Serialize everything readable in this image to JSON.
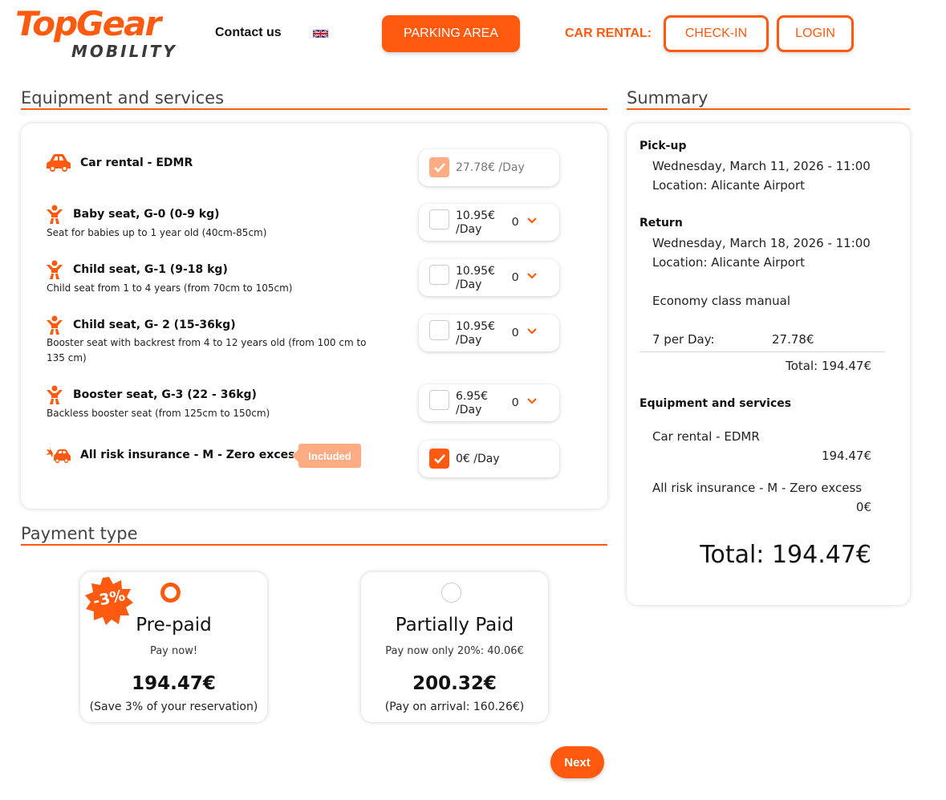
{
  "header": {
    "logo_top": "TopGear",
    "logo_bottom": "MOBILITY",
    "contact_label": "Contact us",
    "parking_label": "PARKING AREA",
    "car_rental_label": "CAR RENTAL:",
    "checkin_label": "CHECK-IN",
    "login_label": "LOGIN"
  },
  "equipment": {
    "title": "Equipment and services",
    "items": [
      {
        "title": "Car rental - EDMR",
        "desc": "",
        "price": "27.78€ /Day",
        "checked": true,
        "disabled": true
      },
      {
        "title": "Baby seat, G-0 (0-9 kg)",
        "desc": "Seat for babies up to 1 year old (40cm-85cm)",
        "price_line1": "10.95€",
        "price_line2": "/Day",
        "qty": "0"
      },
      {
        "title": "Child seat, G-1 (9-18 kg)",
        "desc": "Child seat from 1 to 4 years (from 70cm to 105cm)",
        "price_line1": "10.95€",
        "price_line2": "/Day",
        "qty": "0"
      },
      {
        "title": "Child seat, G- 2 (15-36kg)",
        "desc": "Booster seat with backrest from 4 to 12 years old (from 100 cm to 135 cm)",
        "price_line1": "10.95€",
        "price_line2": "/Day",
        "qty": "0"
      },
      {
        "title": "Booster seat, G-3 (22 - 36kg)",
        "desc": "Backless booster seat (from 125cm to 150cm)",
        "price_line1": "6.95€",
        "price_line2": "/Day",
        "qty": "0"
      },
      {
        "title": "All risk insurance - M - Zero excess",
        "badge": "Included",
        "price": "0€ /Day",
        "checked": true
      }
    ]
  },
  "summary": {
    "title": "Summary",
    "pickup_label": "Pick-up",
    "pickup_date": "Wednesday, March 11, 2026 - 11:00",
    "pickup_location": "Location: Alicante Airport",
    "return_label": "Return",
    "return_date": "Wednesday, March 18, 2026 - 11:00",
    "return_location": "Location: Alicante Airport",
    "car_class": "Economy class manual",
    "per_day_label": "7 per Day:",
    "per_day_value": "27.78€",
    "subtotal": "Total: 194.47€",
    "equipment_label": "Equipment and services",
    "line1_name": "Car rental - EDMR",
    "line1_value": "194.47€",
    "line2_name": "All risk insurance - M - Zero excess",
    "line2_value": "0€",
    "grand_total": "Total: 194.47€"
  },
  "payment": {
    "title": "Payment type",
    "discount_badge": "-3%",
    "prepaid": {
      "name": "Pre-paid",
      "sub": "Pay now!",
      "amount": "194.47€",
      "note": "(Save 3% of your reservation)",
      "selected": true
    },
    "partial": {
      "name": "Partially Paid",
      "sub": "Pay now only 20%: 40.06€",
      "amount": "200.32€",
      "note": "(Pay on arrival: 160.26€)",
      "selected": false
    }
  },
  "next_label": "Next",
  "icons": {
    "car": "car-icon",
    "child": "child-seat-icon",
    "insurance": "car-crash-icon",
    "check": "check-icon",
    "chevron": "chevron-down-icon",
    "flag": "uk-flag-icon"
  },
  "colors": {
    "accent": "#ff5a10",
    "accent_light": "#ffac85"
  }
}
